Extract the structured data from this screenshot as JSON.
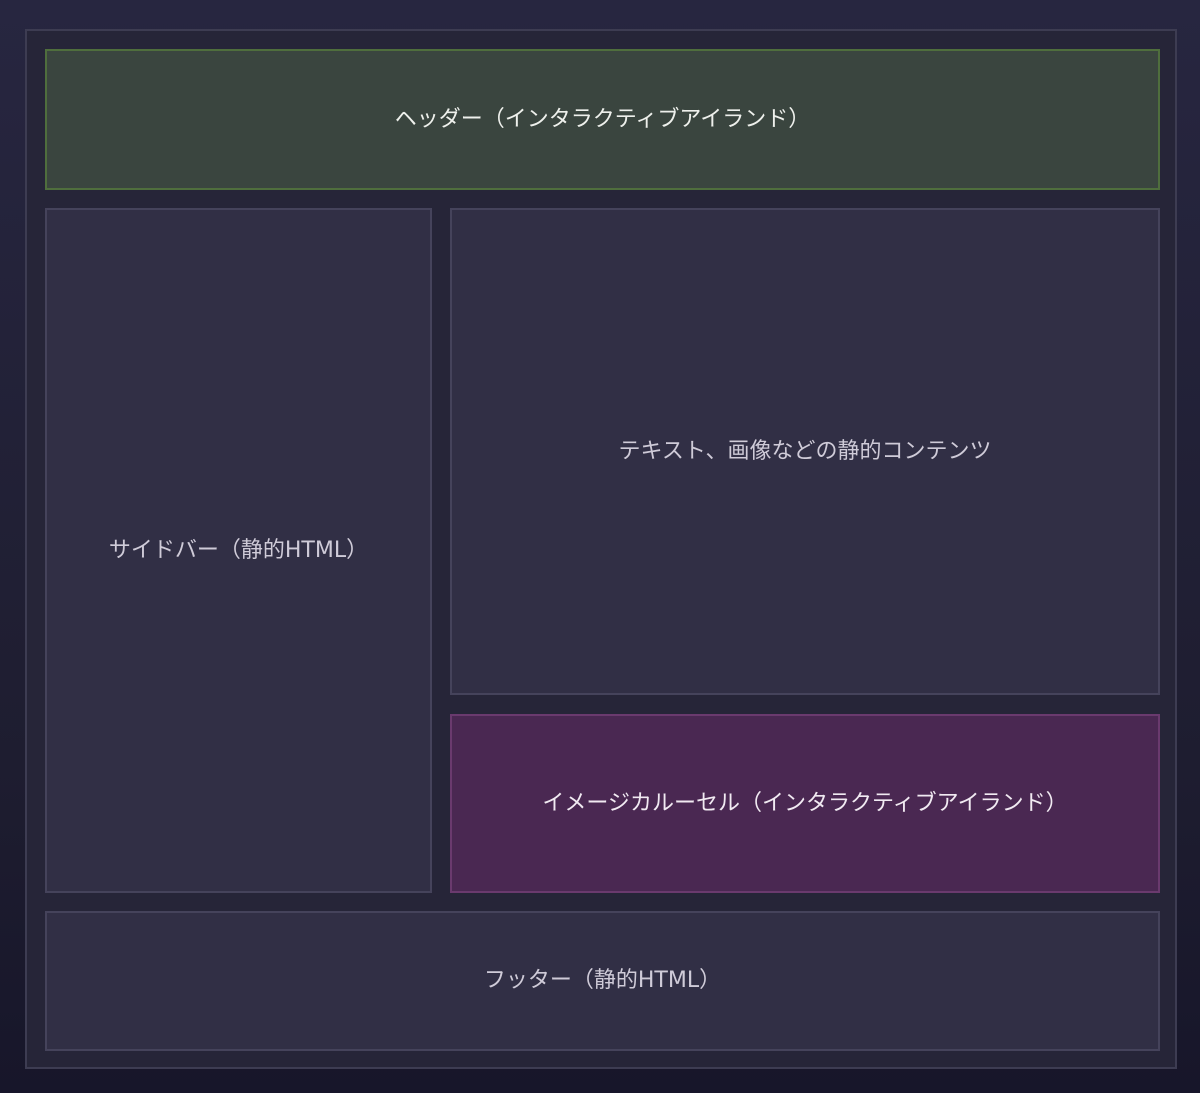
{
  "regions": {
    "header": "ヘッダー（インタラクティブアイランド）",
    "sidebar": "サイドバー（静的HTML）",
    "content": "テキスト、画像などの静的コンテンツ",
    "carousel": "イメージカルーセル（インタラクティブアイランド）",
    "footer": "フッター（静的HTML）"
  }
}
